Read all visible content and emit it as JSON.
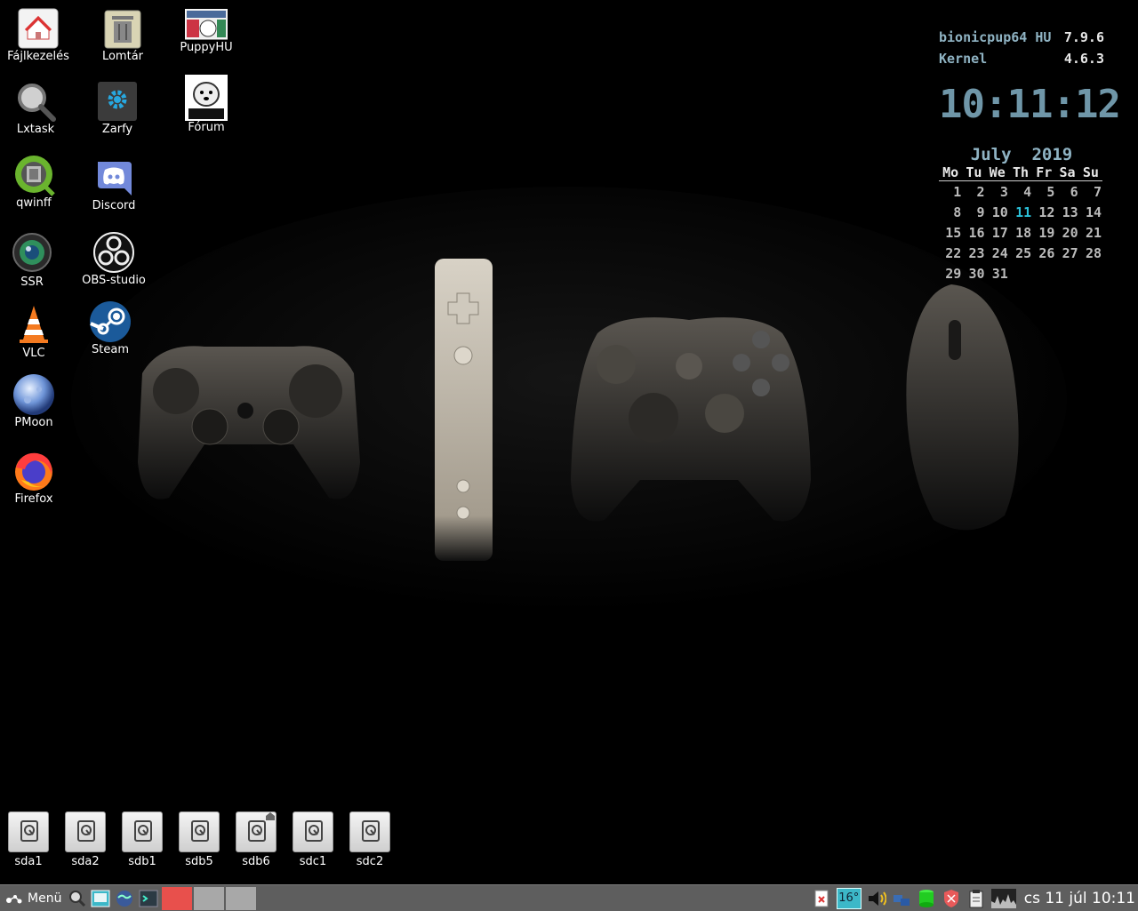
{
  "desktop_icons": [
    {
      "id": "fajlkezeles",
      "label": "Fájlkezelés",
      "icon": "home-folder-icon"
    },
    {
      "id": "lomtar",
      "label": "Lomtár",
      "icon": "trash-icon"
    },
    {
      "id": "puppyhu",
      "label": "PuppyHU",
      "icon": "puppyhu-icon"
    },
    {
      "id": "lxtask",
      "label": "Lxtask",
      "icon": "magnifier-icon"
    },
    {
      "id": "zarfy",
      "label": "Zarfy",
      "icon": "gear-icon"
    },
    {
      "id": "forum",
      "label": "Fórum",
      "icon": "puppy-linux-icon"
    },
    {
      "id": "qwinff",
      "label": "qwinff",
      "icon": "qwinff-icon"
    },
    {
      "id": "discord",
      "label": "Discord",
      "icon": "discord-icon"
    },
    {
      "id": "ssr",
      "label": "SSR",
      "icon": "record-lens-icon"
    },
    {
      "id": "obs",
      "label": "OBS-studio",
      "icon": "obs-icon"
    },
    {
      "id": "vlc",
      "label": "VLC",
      "icon": "vlc-cone-icon"
    },
    {
      "id": "steam",
      "label": "Steam",
      "icon": "steam-icon"
    },
    {
      "id": "pmoon",
      "label": "PMoon",
      "icon": "moon-icon"
    },
    {
      "id": "firefox",
      "label": "Firefox",
      "icon": "firefox-icon"
    }
  ],
  "drives": [
    "sda1",
    "sda2",
    "sdb1",
    "sdb5",
    "sdb6",
    "sdc1",
    "sdc2"
  ],
  "conky": {
    "distro_label": "bionicpup64 HU",
    "distro_version": "7.9.6",
    "kernel_label": "Kernel",
    "kernel_version": "4.6.3",
    "clock": "10:11:12",
    "calendar_month": "July",
    "calendar_year": "2019",
    "weekdays": [
      "Mo",
      "Tu",
      "We",
      "Th",
      "Fr",
      "Sa",
      "Su"
    ],
    "weeks": [
      [
        "1",
        "2",
        "3",
        "4",
        "5",
        "6",
        "7"
      ],
      [
        "8",
        "9",
        "10",
        "11",
        "12",
        "13",
        "14"
      ],
      [
        "15",
        "16",
        "17",
        "18",
        "19",
        "20",
        "21"
      ],
      [
        "22",
        "23",
        "24",
        "25",
        "26",
        "27",
        "28"
      ],
      [
        "29",
        "30",
        "31",
        "",
        "",
        "",
        ""
      ]
    ],
    "today": "11"
  },
  "taskbar": {
    "menu_label": "Menü",
    "temperature": "16°",
    "clock": "cs 11 júl 10:11",
    "colors": {
      "panel": "#5e5e5e",
      "accent_window": "#e8504c",
      "inactive_window": "#a8a8a8"
    }
  }
}
